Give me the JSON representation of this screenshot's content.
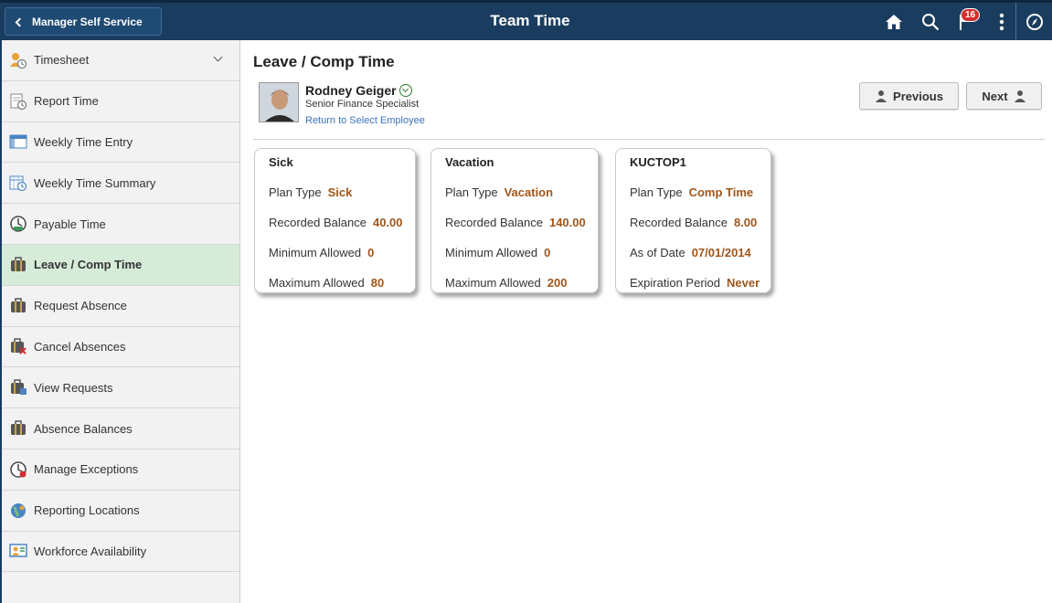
{
  "banner": {
    "back_label": "Manager Self Service",
    "title": "Team Time",
    "notification_count": "16",
    "color": "#1a3d5f"
  },
  "sidebar": {
    "items": [
      {
        "label": "Timesheet",
        "icon": "timesheet-icon"
      },
      {
        "label": "Report Time",
        "icon": "report-time-icon"
      },
      {
        "label": "Weekly Time Entry",
        "icon": "weekly-time-entry-icon"
      },
      {
        "label": "Weekly Time Summary",
        "icon": "weekly-time-summary-icon"
      },
      {
        "label": "Payable Time",
        "icon": "payable-time-icon"
      },
      {
        "label": "Leave / Comp Time",
        "icon": "leave-comp-time-icon"
      },
      {
        "label": "Request Absence",
        "icon": "request-absence-icon"
      },
      {
        "label": "Cancel Absences",
        "icon": "cancel-absences-icon"
      },
      {
        "label": "View Requests",
        "icon": "view-requests-icon"
      },
      {
        "label": "Absence Balances",
        "icon": "absence-balances-icon"
      },
      {
        "label": "Manage Exceptions",
        "icon": "manage-exceptions-icon"
      },
      {
        "label": "Reporting Locations",
        "icon": "reporting-locations-icon"
      },
      {
        "label": "Workforce Availability",
        "icon": "workforce-availability-icon"
      }
    ],
    "active_index": 5,
    "active_color": "#d6ecd9"
  },
  "main": {
    "title": "Leave / Comp Time",
    "employee": {
      "name": "Rodney Geiger",
      "role": "Senior Finance Specialist",
      "return_link": "Return to Select Employee"
    },
    "previous_label": "Previous",
    "next_label": "Next",
    "value_color": "#a0561a",
    "cards": [
      {
        "title": "Sick",
        "rows": [
          {
            "label": "Plan Type",
            "value": "Sick"
          },
          {
            "label": "Recorded Balance",
            "value": "40.00"
          },
          {
            "label": "Minimum Allowed",
            "value": "0"
          },
          {
            "label": "Maximum Allowed",
            "value": "80"
          }
        ]
      },
      {
        "title": "Vacation",
        "rows": [
          {
            "label": "Plan Type",
            "value": "Vacation"
          },
          {
            "label": "Recorded Balance",
            "value": "140.00"
          },
          {
            "label": "Minimum Allowed",
            "value": "0"
          },
          {
            "label": "Maximum Allowed",
            "value": "200"
          }
        ]
      },
      {
        "title": "KUCTOP1",
        "rows": [
          {
            "label": "Plan Type",
            "value": "Comp Time"
          },
          {
            "label": "Recorded Balance",
            "value": "8.00"
          },
          {
            "label": "As of Date",
            "value": "07/01/2014"
          },
          {
            "label": "Expiration Period",
            "value": "Never"
          }
        ]
      }
    ]
  }
}
